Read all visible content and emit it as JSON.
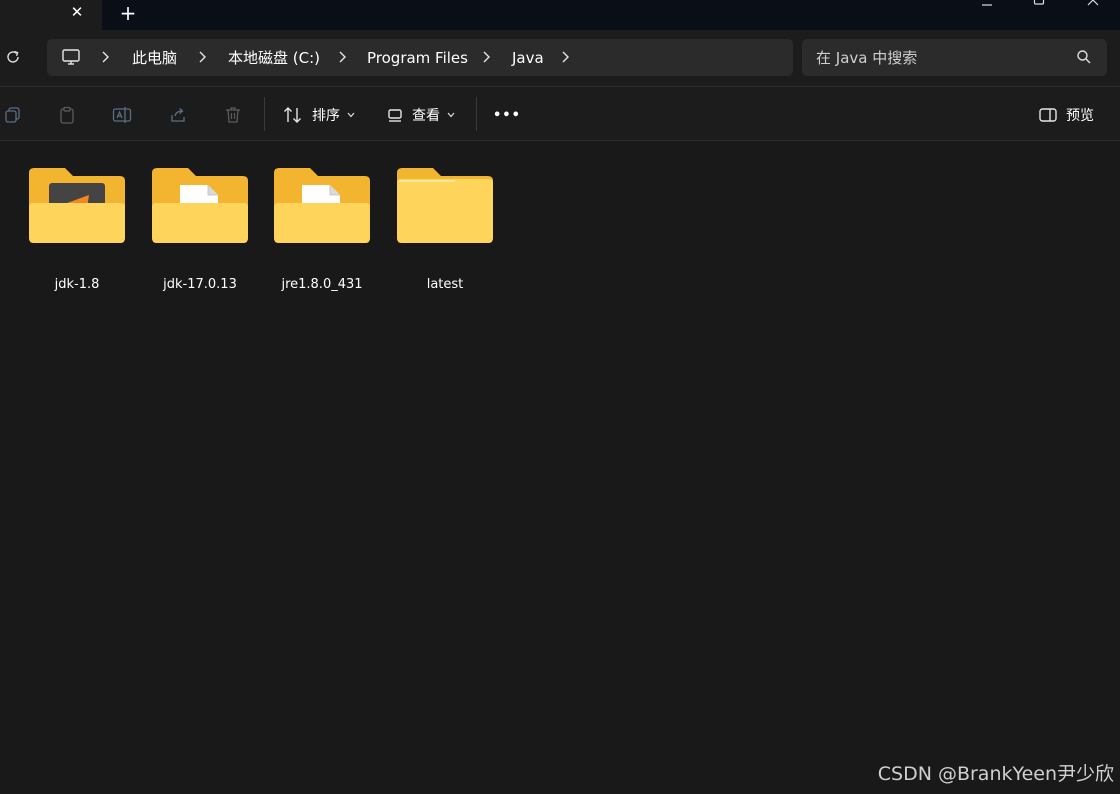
{
  "window": {
    "tab": {
      "close_glyph": "✕"
    },
    "new_tab_glyph": "+"
  },
  "address": {
    "root_icon": "this-pc-icon",
    "crumbs": [
      "此电脑",
      "本地磁盘 (C:)",
      "Program Files",
      "Java"
    ]
  },
  "search": {
    "placeholder": "在 Java 中搜索"
  },
  "toolbar": {
    "sort_label": "排序",
    "view_label": "查看",
    "more_label": "•••",
    "preview_label": "预览"
  },
  "folders": [
    {
      "name": "jdk-1.8",
      "icon": "folder-java-icon"
    },
    {
      "name": "jdk-17.0.13",
      "icon": "folder-document-icon"
    },
    {
      "name": "jre1.8.0_431",
      "icon": "folder-document-icon"
    },
    {
      "name": "latest",
      "icon": "folder-icon"
    }
  ],
  "watermark": "CSDN @BrankYeen尹少欣",
  "colors": {
    "background": "#191919",
    "titlebar": "#0a0e17",
    "field": "#2b2b2b",
    "folder_back": "#f3b52f",
    "folder_front": "#ffd86a"
  }
}
